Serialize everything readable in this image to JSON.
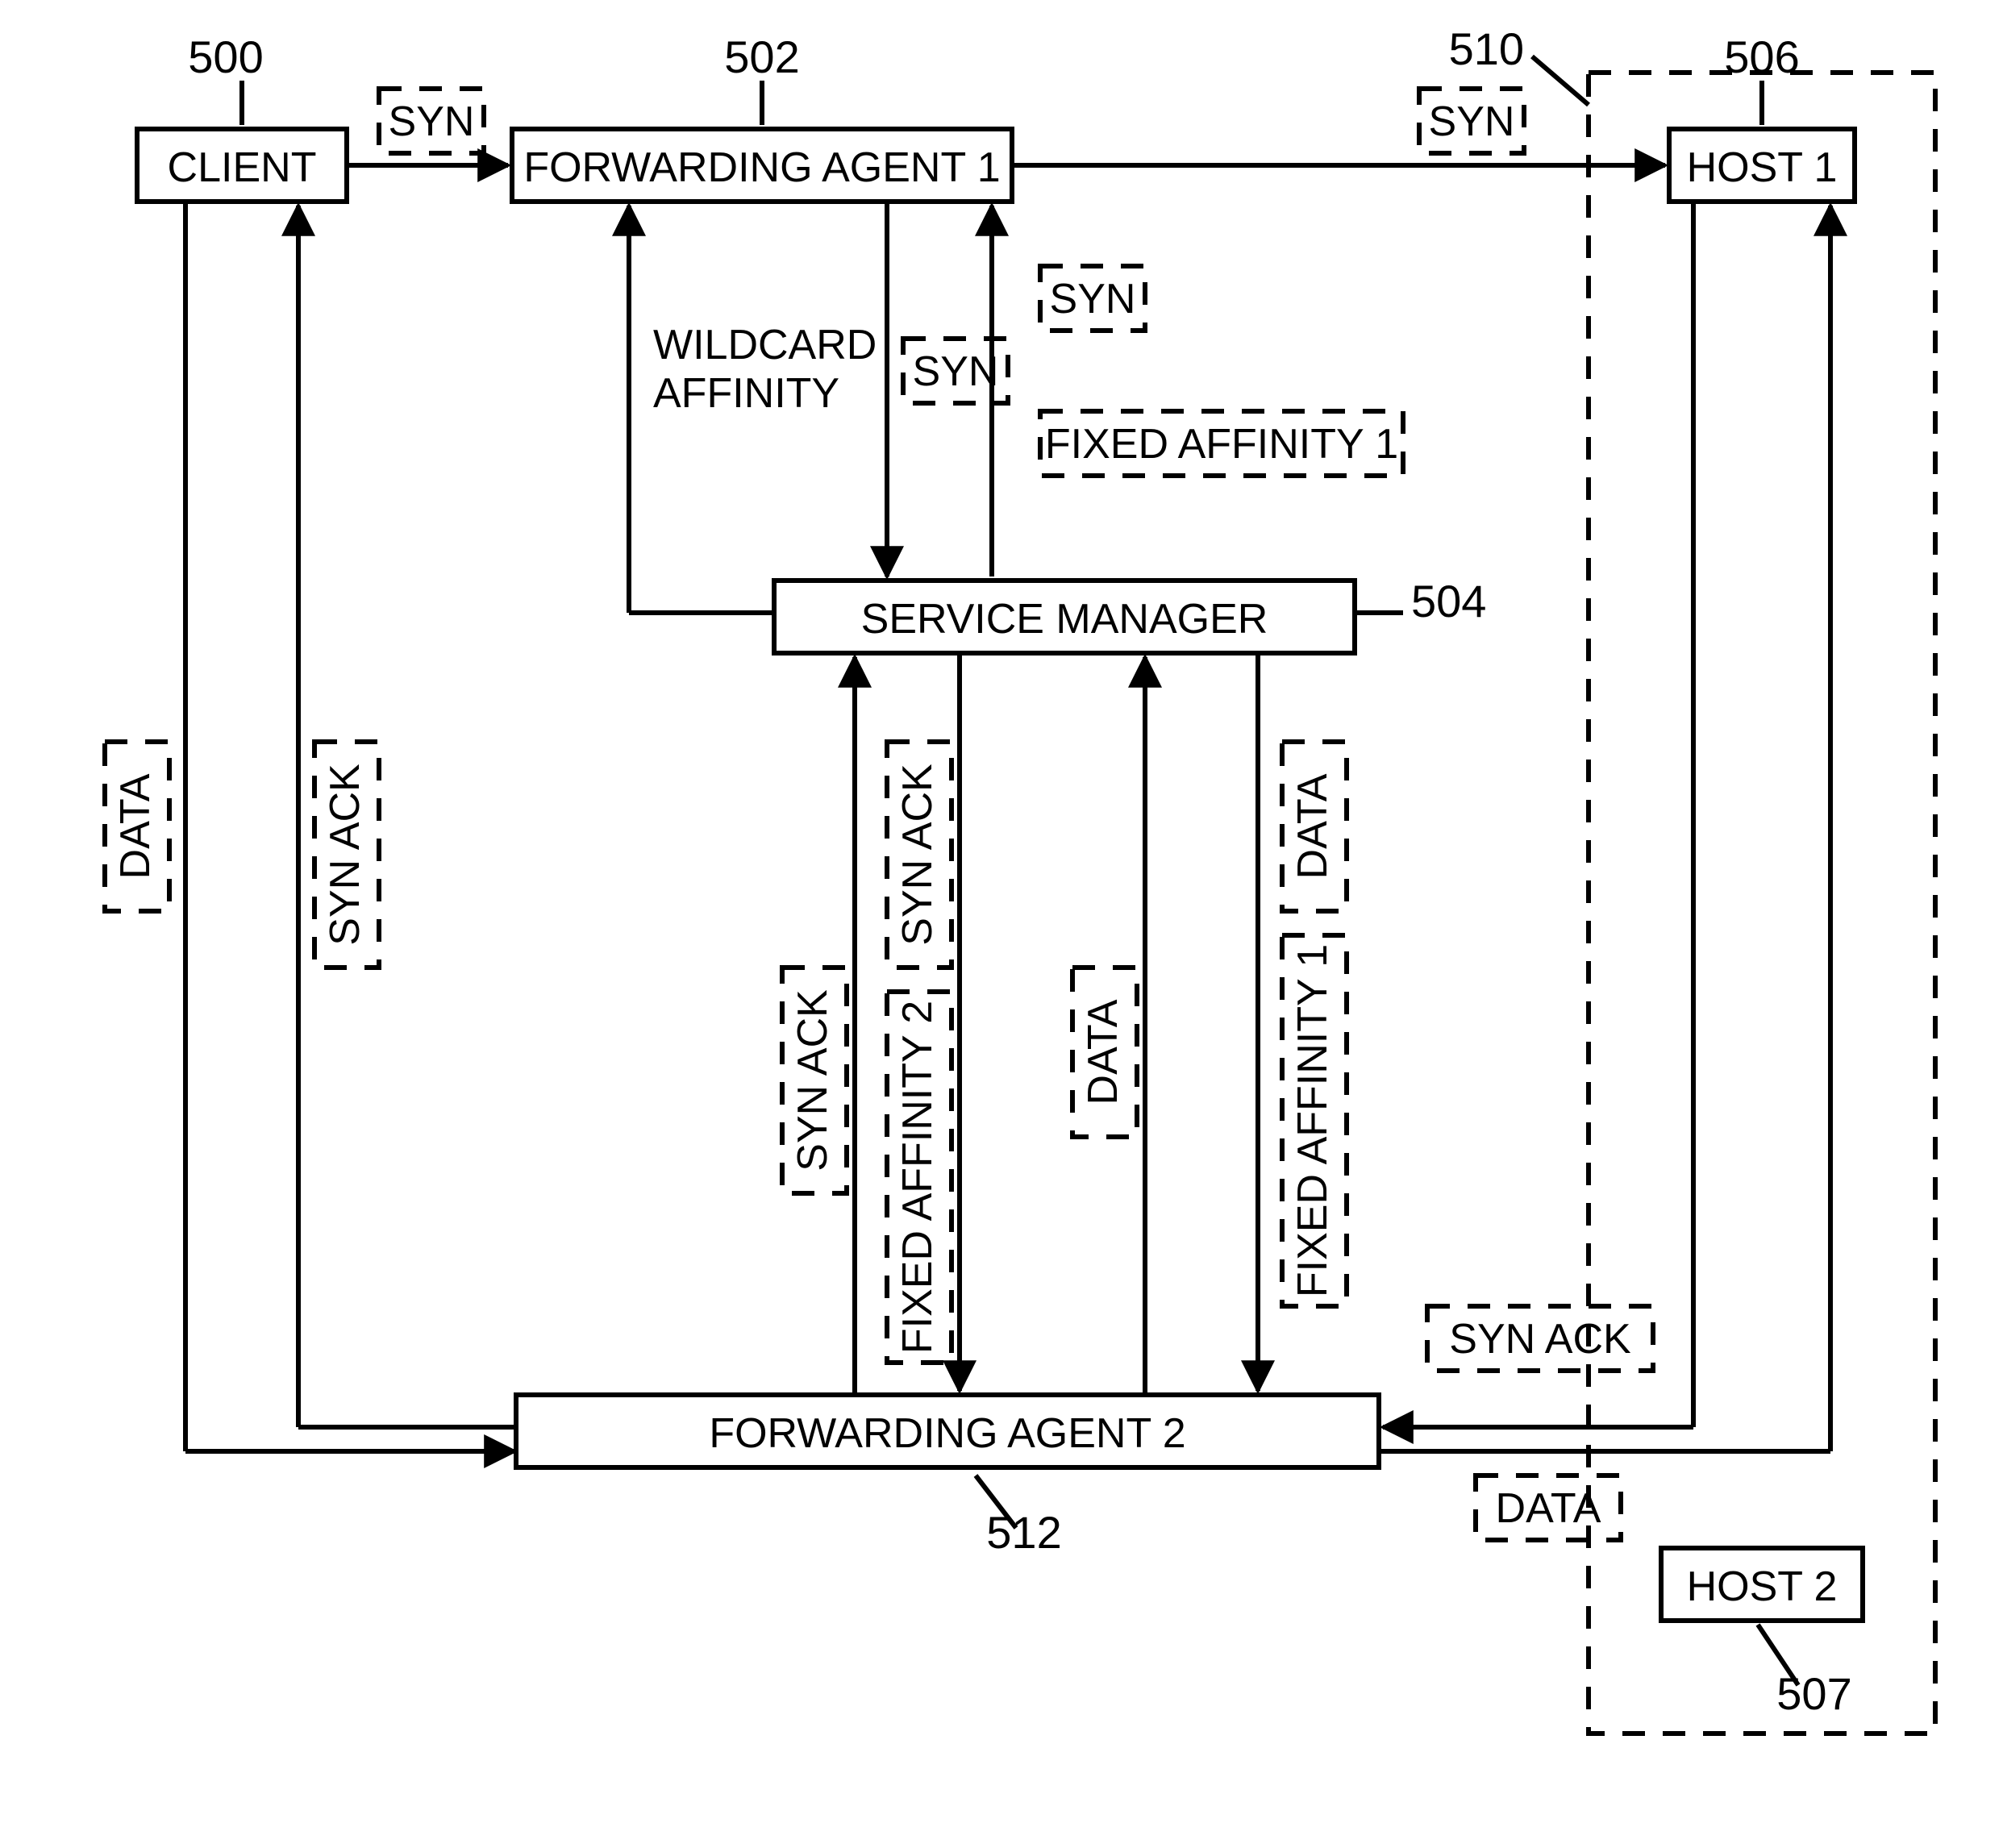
{
  "refs": {
    "r500": "500",
    "r502": "502",
    "r504": "504",
    "r506": "506",
    "r507": "507",
    "r510": "510",
    "r512": "512"
  },
  "nodes": {
    "client": "CLIENT",
    "fa1": "FORWARDING AGENT 1",
    "fa2": "FORWARDING AGENT 2",
    "svc": "SERVICE MANAGER",
    "host1": "HOST 1",
    "host2": "HOST 2"
  },
  "msgs": {
    "syn": "SYN",
    "synack": "SYN ACK",
    "data": "DATA",
    "fixed1": "FIXED AFFINITY 1",
    "fixed2": "FIXED AFFINITY 2",
    "wildcard": "WILDCARD\nAFFINITY"
  }
}
